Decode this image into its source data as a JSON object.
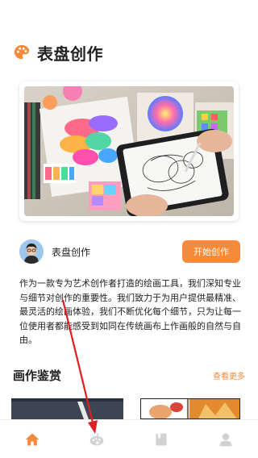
{
  "header": {
    "icon": "palette-icon",
    "title": "表盘创作"
  },
  "hero": {
    "image": "artist-drawing-tablet-image"
  },
  "author": {
    "avatar": "user-avatar",
    "name": "表盘创作",
    "start_button": "开始创作"
  },
  "description": "作为一款专为艺术创作者打造的绘画工具，我们深知专业与细节对创作的重要性。我们致力于为用户提供最精准、最灵活的绘画体验，我们不断优化每个细节，只为让每一位使用者都能感受到如同在传统画布上作画般的自然与自由。",
  "gallery": {
    "title": "画作鉴赏",
    "view_more": "查看更多"
  },
  "tabbar": {
    "items": [
      {
        "icon": "home-icon",
        "active": true
      },
      {
        "icon": "palette-tab-icon",
        "active": false
      },
      {
        "icon": "book-icon",
        "active": false
      },
      {
        "icon": "profile-icon",
        "active": false
      }
    ]
  },
  "colors": {
    "accent": "#f58a3a",
    "tab_inactive": "#d2d2d2",
    "annotation_arrow": "#e02020"
  }
}
